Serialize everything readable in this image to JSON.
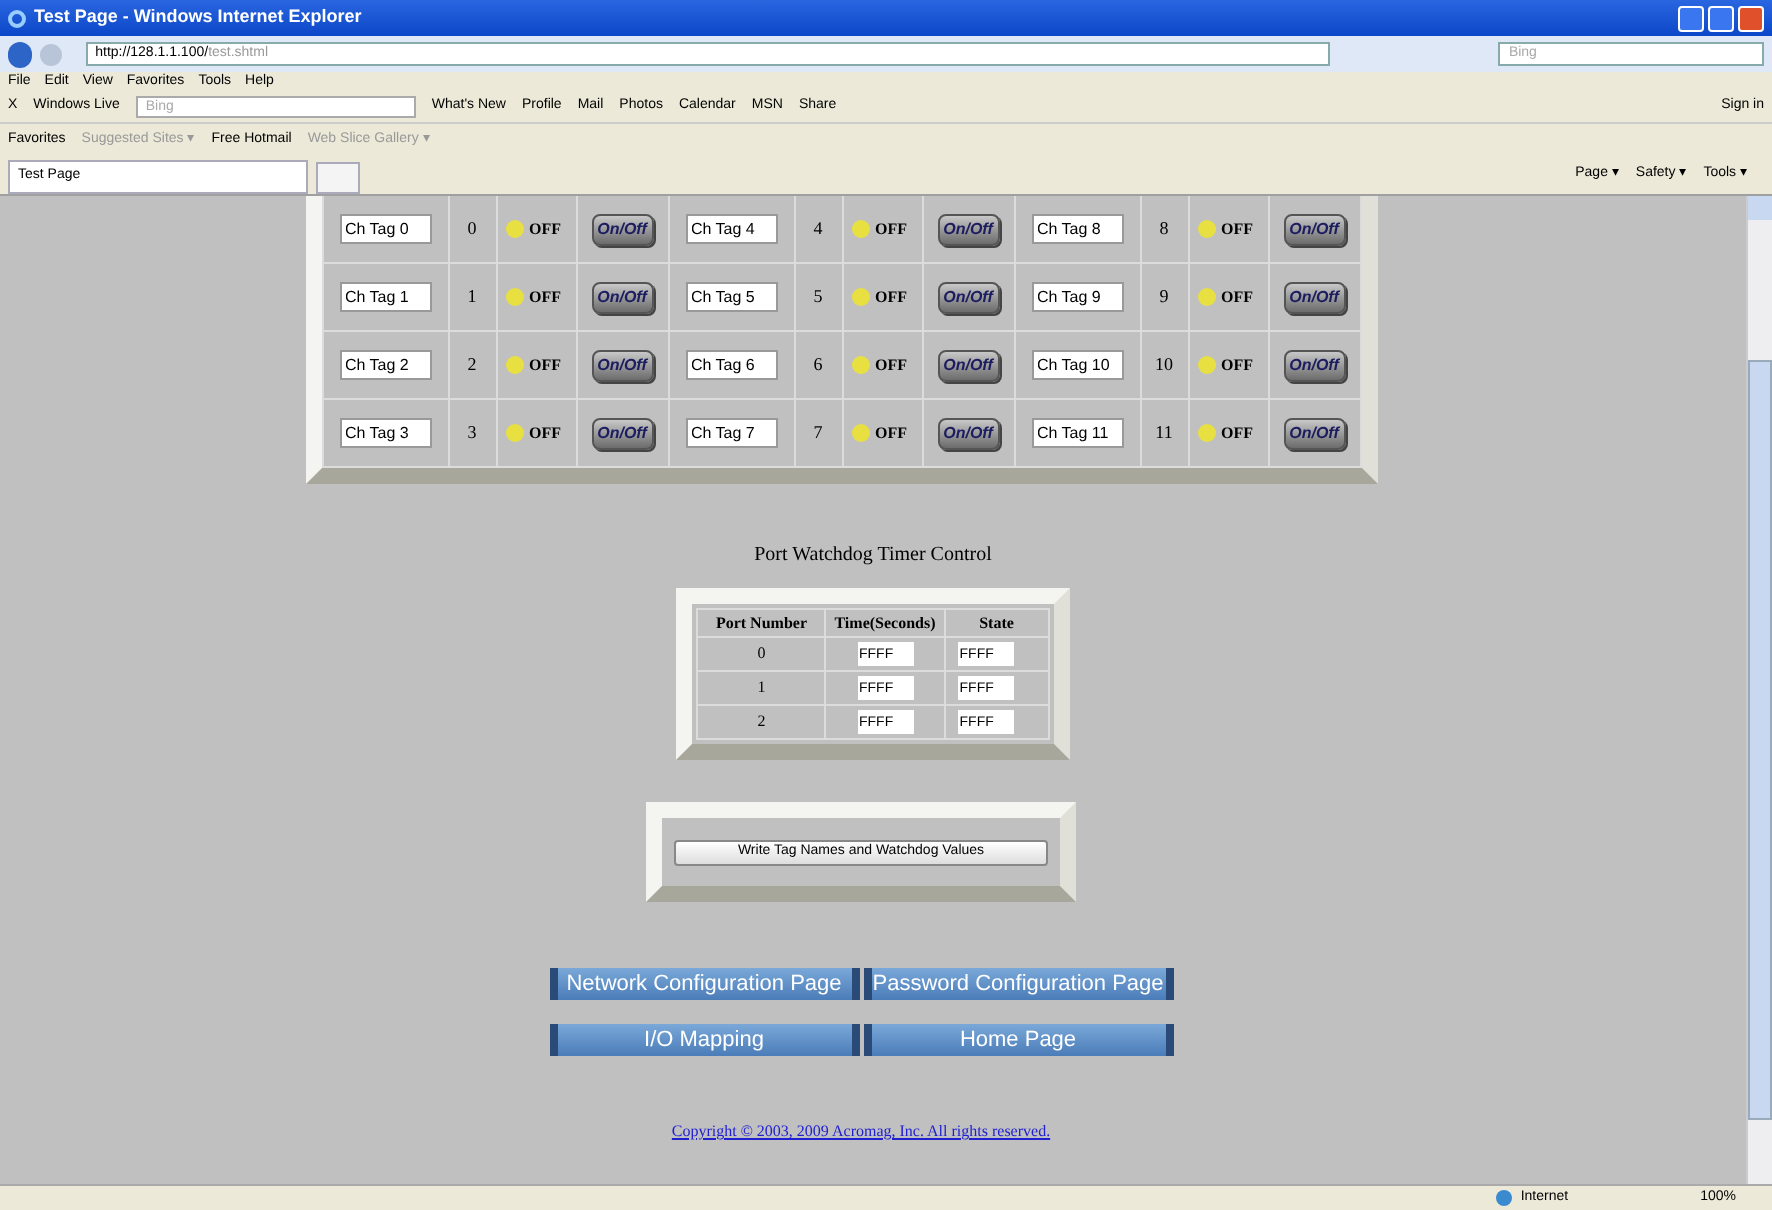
{
  "window": {
    "title": "Test Page - Windows Internet Explorer"
  },
  "address_bar": {
    "url_host": "http://128.1.1.100/",
    "url_path": "test.shtml",
    "search_placeholder": "Bing"
  },
  "menu": [
    "File",
    "Edit",
    "View",
    "Favorites",
    "Tools",
    "Help"
  ],
  "toolbar": {
    "close": "X",
    "brand": "Windows Live",
    "search_placeholder": "Bing",
    "links": [
      "What's New",
      "Profile",
      "Mail",
      "Photos",
      "Calendar",
      "MSN",
      "Share"
    ],
    "sign_in": "Sign in"
  },
  "favorites_bar": {
    "favorites": "Favorites",
    "links": [
      "Suggested Sites ▾",
      "Free Hotmail",
      "Web Slice Gallery ▾"
    ]
  },
  "tab": {
    "title": "Test Page"
  },
  "command_bar": [
    "Page ▾",
    "Safety ▾",
    "Tools ▾"
  ],
  "channels": [
    {
      "tag": "Ch Tag 0",
      "number": "0",
      "status": "OFF",
      "button": "On/Off"
    },
    {
      "tag": "Ch Tag 1",
      "number": "1",
      "status": "OFF",
      "button": "On/Off"
    },
    {
      "tag": "Ch Tag 2",
      "number": "2",
      "status": "OFF",
      "button": "On/Off"
    },
    {
      "tag": "Ch Tag 3",
      "number": "3",
      "status": "OFF",
      "button": "On/Off"
    },
    {
      "tag": "Ch Tag 4",
      "number": "4",
      "status": "OFF",
      "button": "On/Off"
    },
    {
      "tag": "Ch Tag 5",
      "number": "5",
      "status": "OFF",
      "button": "On/Off"
    },
    {
      "tag": "Ch Tag 6",
      "number": "6",
      "status": "OFF",
      "button": "On/Off"
    },
    {
      "tag": "Ch Tag 7",
      "number": "7",
      "status": "OFF",
      "button": "On/Off"
    },
    {
      "tag": "Ch Tag 8",
      "number": "8",
      "status": "OFF",
      "button": "On/Off"
    },
    {
      "tag": "Ch Tag 9",
      "number": "9",
      "status": "OFF",
      "button": "On/Off"
    },
    {
      "tag": "Ch Tag 10",
      "number": "10",
      "status": "OFF",
      "button": "On/Off"
    },
    {
      "tag": "Ch Tag 11",
      "number": "11",
      "status": "OFF",
      "button": "On/Off"
    }
  ],
  "watchdog": {
    "title": "Port Watchdog Timer Control",
    "columns": [
      "Port Number",
      "Time(Seconds)",
      "State"
    ],
    "rows": [
      {
        "port": "0",
        "time": "FFFF",
        "state": "FFFF"
      },
      {
        "port": "1",
        "time": "FFFF",
        "state": "FFFF"
      },
      {
        "port": "2",
        "time": "FFFF",
        "state": "FFFF"
      }
    ]
  },
  "write_button": "Write Tag Names and Watchdog Values",
  "nav_buttons": [
    "Network Configuration Page",
    "Password Configuration Page",
    "I/O Mapping",
    "Home Page"
  ],
  "copyright": "Copyright © 2003, 2009 Acromag, Inc. All rights reserved.",
  "status_bar": {
    "zone": "Internet",
    "zoom": "100%"
  }
}
